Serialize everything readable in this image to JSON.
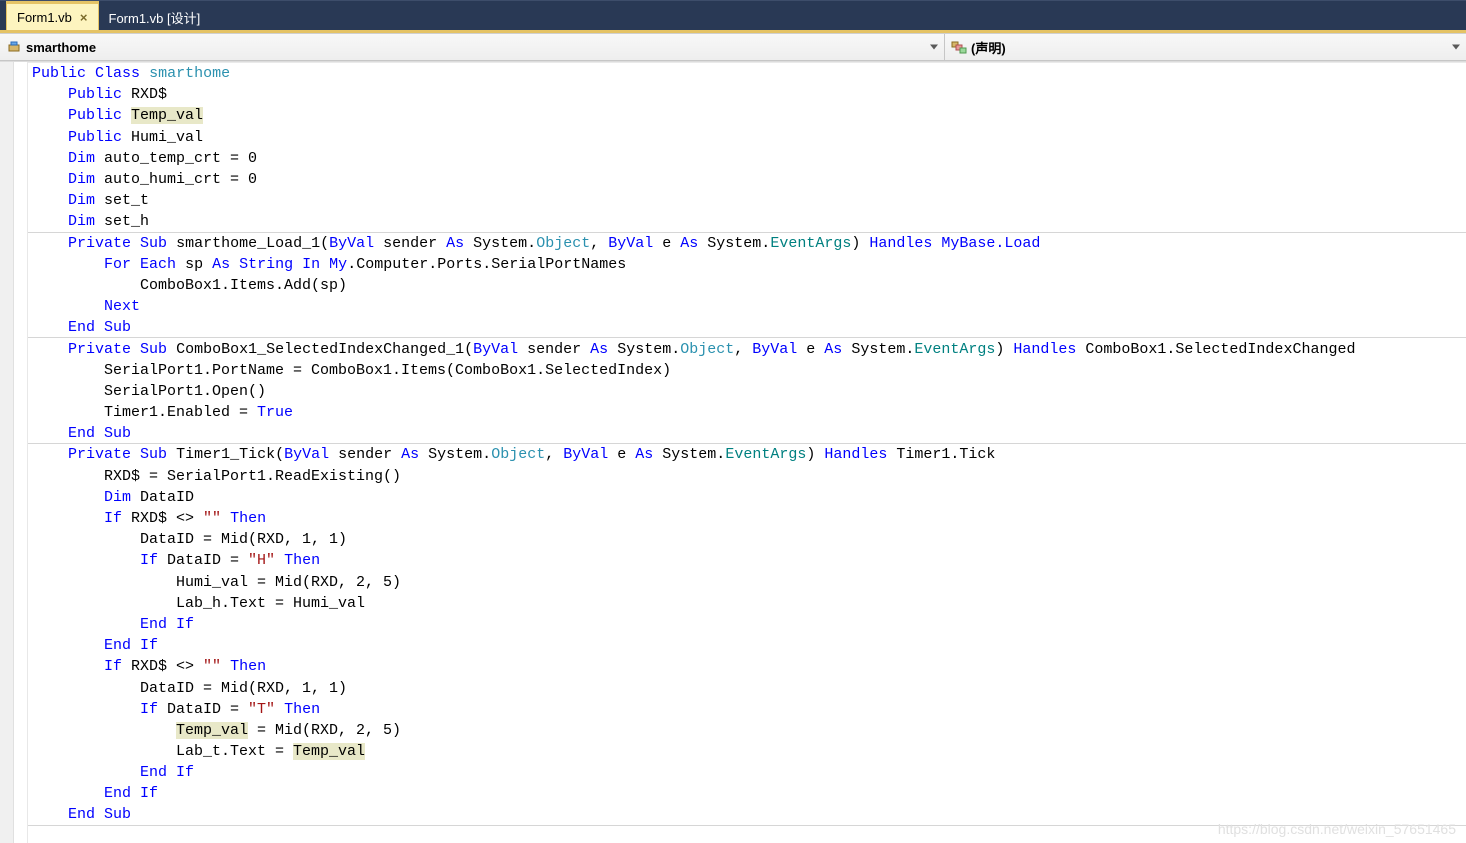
{
  "tabs": [
    {
      "label": "Form1.vb",
      "active": true
    },
    {
      "label": "Form1.vb [设计]",
      "active": false
    }
  ],
  "toolbar": {
    "class_dropdown": "smarthome",
    "member_dropdown": "(声明)"
  },
  "code": {
    "l1": {
      "kw1": "Public",
      "kw2": "Class",
      "cls": "smarthome"
    },
    "l2": {
      "kw": "Public",
      "id": "RXD$"
    },
    "l3": {
      "kw": "Public",
      "id": "Temp_val"
    },
    "l4": {
      "kw": "Public",
      "id": "Humi_val"
    },
    "l5": {
      "kw": "Dim",
      "rest": "auto_temp_crt = 0"
    },
    "l6": {
      "kw": "Dim",
      "rest": "auto_humi_crt = 0"
    },
    "l7": {
      "kw": "Dim",
      "rest": "set_t"
    },
    "l8": {
      "kw": "Dim",
      "rest": "set_h"
    },
    "l9": {
      "kw1": "Private",
      "kw2": "Sub",
      "name": "smarthome_Load_1(",
      "kw3": "ByVal",
      "a1": "sender ",
      "kw4": "As",
      "sys1": "System.",
      "obj": "Object",
      "c1": ", ",
      "kw5": "ByVal",
      "a2": "e ",
      "kw6": "As",
      "sys2": "System.",
      "ea": "EventArgs",
      "c2": ") ",
      "kw7": "Handles",
      "tail": "MyBase.Load"
    },
    "l10": {
      "kw1": "For",
      "kw2": "Each",
      "a": "sp ",
      "kw3": "As",
      "kw4": "String",
      "kw5": "In",
      "kw6": "My",
      "rest": ".Computer.Ports.SerialPortNames"
    },
    "l11": {
      "txt": "ComboBox1.Items.Add(sp)"
    },
    "l12": {
      "kw": "Next"
    },
    "l13": {
      "kw1": "End",
      "kw2": "Sub"
    },
    "l14": {
      "kw1": "Private",
      "kw2": "Sub",
      "name": "ComboBox1_SelectedIndexChanged_1(",
      "kw3": "ByVal",
      "a1": "sender ",
      "kw4": "As",
      "sys1": "System.",
      "obj": "Object",
      "c1": ", ",
      "kw5": "ByVal",
      "a2": "e ",
      "kw6": "As",
      "sys2": "System.",
      "ea": "EventArgs",
      "c2": ") ",
      "kw7": "Handles",
      "tail": "ComboBox1.SelectedIndexChanged"
    },
    "l15": {
      "txt": "SerialPort1.PortName = ComboBox1.Items(ComboBox1.SelectedIndex)"
    },
    "l16": {
      "txt": "SerialPort1.Open()"
    },
    "l17": {
      "t1": "Timer1.Enabled = ",
      "kw": "True"
    },
    "l18": {
      "kw1": "End",
      "kw2": "Sub"
    },
    "l19": {
      "kw1": "Private",
      "kw2": "Sub",
      "name": "Timer1_Tick(",
      "kw3": "ByVal",
      "a1": "sender ",
      "kw4": "As",
      "sys1": "System.",
      "obj": "Object",
      "c1": ", ",
      "kw5": "ByVal",
      "a2": "e ",
      "kw6": "As",
      "sys2": "System.",
      "ea": "EventArgs",
      "c2": ") ",
      "kw7": "Handles",
      "tail": "Timer1.Tick"
    },
    "l20": {
      "txt": "RXD$ = SerialPort1.ReadExisting()"
    },
    "l21": {
      "kw": "Dim",
      "rest": "DataID"
    },
    "l22": {
      "kw1": "If",
      "a": "RXD$ <> ",
      "str": "\"\"",
      "kw2": "Then"
    },
    "l23": {
      "txt": "DataID = Mid(RXD, 1, 1)"
    },
    "l24": {
      "kw1": "If",
      "a": "DataID = ",
      "str": "\"H\"",
      "kw2": "Then"
    },
    "l25": {
      "txt": "Humi_val = Mid(RXD, 2, 5)"
    },
    "l26": {
      "txt": "Lab_h.Text = Humi_val"
    },
    "l27": {
      "kw1": "End",
      "kw2": "If"
    },
    "l28": {
      "kw1": "End",
      "kw2": "If"
    },
    "l29": {
      "kw1": "If",
      "a": "RXD$ <> ",
      "str": "\"\"",
      "kw2": "Then"
    },
    "l30": {
      "txt": "DataID = Mid(RXD, 1, 1)"
    },
    "l31": {
      "kw1": "If",
      "a": "DataID = ",
      "str": "\"T\"",
      "kw2": "Then"
    },
    "l32": {
      "t1": "Temp_val",
      "t2": " = Mid(RXD, 2, 5)"
    },
    "l33": {
      "t1": "Lab_t.Text = ",
      "t2": "Temp_val"
    },
    "l34": {
      "kw1": "End",
      "kw2": "If"
    },
    "l35": {
      "kw1": "End",
      "kw2": "If"
    },
    "l36": {
      "kw1": "End",
      "kw2": "Sub"
    }
  },
  "watermark": "https://blog.csdn.net/weixin_57651465"
}
